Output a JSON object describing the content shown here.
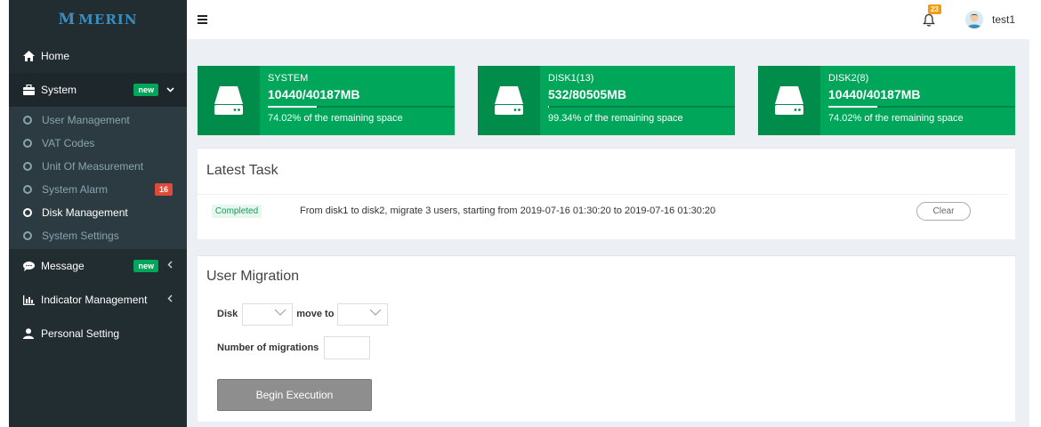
{
  "brand": {
    "name": "MERIN",
    "mark": "M"
  },
  "sidebar": {
    "items": [
      {
        "label": "Home",
        "icon": "home-icon"
      },
      {
        "label": "System",
        "icon": "briefcase-icon",
        "badge": "new",
        "expanded": true
      },
      {
        "label": "Message",
        "icon": "comment-icon",
        "badge": "new"
      },
      {
        "label": "Indicator Management",
        "icon": "bar-chart-icon"
      },
      {
        "label": "Personal Setting",
        "icon": "user-icon"
      }
    ],
    "system_sub": [
      {
        "label": "User Management"
      },
      {
        "label": "VAT Codes"
      },
      {
        "label": "Unit Of Measurement"
      },
      {
        "label": "System Alarm",
        "badge": "16"
      },
      {
        "label": "Disk Management",
        "active": true
      },
      {
        "label": "System Settings"
      }
    ]
  },
  "topbar": {
    "menu_icon": "hamburger-icon",
    "notification_count": "23",
    "username": "test1"
  },
  "stats": [
    {
      "name": "SYSTEM",
      "value": "10440/40187MB",
      "desc": "74.02% of the remaining space",
      "progress": 0.2598
    },
    {
      "name": "DISK1(13)",
      "value": "532/80505MB",
      "desc": "99.34% of the remaining space",
      "progress": 0.0066
    },
    {
      "name": "DISK2(8)",
      "value": "10440/40187MB",
      "desc": "74.02% of the remaining space",
      "progress": 0.2598
    }
  ],
  "latest_task": {
    "title": "Latest Task",
    "status": "Completed",
    "text": "From disk1 to disk2, migrate 3 users, starting from 2019-07-16 01:30:20 to 2019-07-16 01:30:20",
    "clear_label": "Clear"
  },
  "migration": {
    "title": "User Migration",
    "disk_label": "Disk",
    "disk_value": "",
    "move_to_label": "move to",
    "move_to_value": "",
    "count_label": "Number of migrations",
    "count_value": "",
    "execute_label": "Begin Execution"
  },
  "colors": {
    "sidebar_bg": "#222d32",
    "accent_green": "#00a65a",
    "accent_green_dark": "#008d4c",
    "danger": "#dd4b39",
    "warning": "#f39c12"
  }
}
